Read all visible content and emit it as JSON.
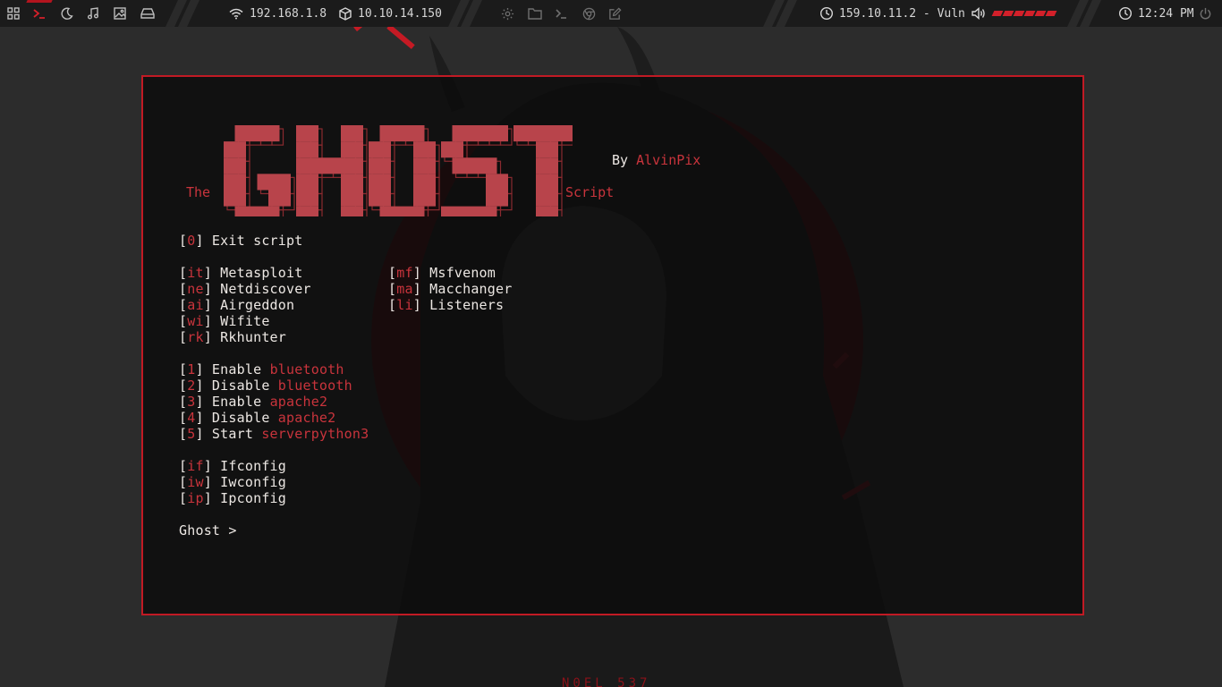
{
  "topbar": {
    "network_wifi_ip": "192.168.1.8",
    "vpn_ip": "10.10.14.150",
    "target": "159.10.11.2 - Vuln",
    "clock": "12:24 PM",
    "volume_level": 1.0,
    "left_icons": [
      "grid-icon",
      "terminal-icon",
      "moon-icon",
      "music-icon",
      "image-icon",
      "drive-icon"
    ],
    "center_icons": [
      "settings-icon",
      "folder-icon",
      "terminal-icon",
      "browser-icon",
      "edit-icon"
    ],
    "accent": "#d3202a"
  },
  "terminal": {
    "banner": {
      "logo": "GHOST",
      "the": "The",
      "script": "Script",
      "by_prefix": "By ",
      "author": "AlvinPix"
    },
    "exit": {
      "key": "0",
      "label": " Exit script"
    },
    "tools_left": [
      {
        "key": "it",
        "label": " Metasploit"
      },
      {
        "key": "ne",
        "label": " Netdiscover"
      },
      {
        "key": "ai",
        "label": " Airgeddon"
      },
      {
        "key": "wi",
        "label": " Wifite"
      },
      {
        "key": "rk",
        "label": " Rkhunter"
      }
    ],
    "tools_right": [
      {
        "key": "mf",
        "label": " Msfvenom"
      },
      {
        "key": "ma",
        "label": " Macchanger"
      },
      {
        "key": "li",
        "label": " Listeners"
      }
    ],
    "services": [
      {
        "key": "1",
        "action": " Enable ",
        "target": "bluetooth"
      },
      {
        "key": "2",
        "action": " Disable ",
        "target": "bluetooth"
      },
      {
        "key": "3",
        "action": " Enable ",
        "target": "apache2"
      },
      {
        "key": "4",
        "action": " Disable ",
        "target": "apache2"
      },
      {
        "key": "5",
        "action": " Start ",
        "target": "serverpython3"
      }
    ],
    "netconfig": [
      {
        "key": "if",
        "label": " Ifconfig"
      },
      {
        "key": "iw",
        "label": " Iwconfig"
      },
      {
        "key": "ip",
        "label": " Ipconfig"
      }
    ],
    "prompt": "Ghost > "
  },
  "colors": {
    "border": "#c11a24",
    "key": "#c9343c",
    "text": "#ece7e3"
  }
}
